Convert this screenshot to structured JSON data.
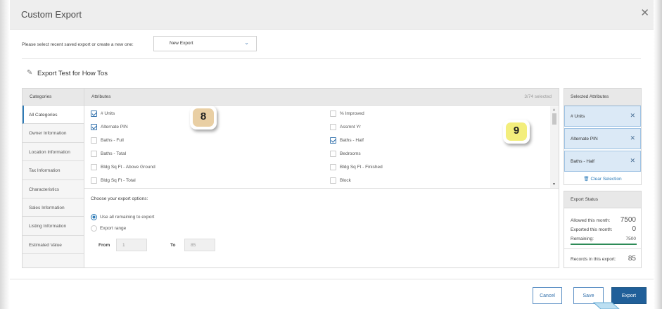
{
  "dialog": {
    "title": "Custom Export"
  },
  "saved_export": {
    "label": "Please select recent saved export or create a new one:",
    "value": "New Export"
  },
  "export_name": "Export Test for How Tos",
  "categories": {
    "header": "Categories",
    "items": [
      "All Categories",
      "Owner Information",
      "Location Information",
      "Tax Information",
      "Characteristics",
      "Sales Information",
      "Listing Information",
      "Estimated Value"
    ],
    "active": "All Categories"
  },
  "attributes": {
    "header": "Attributes",
    "count": "3/74 selected",
    "left_column": [
      {
        "label": "# Units",
        "checked": true
      },
      {
        "label": "Alternate PIN",
        "checked": true
      },
      {
        "label": "Baths - Full",
        "checked": false
      },
      {
        "label": "Baths - Total",
        "checked": false
      },
      {
        "label": "Bldg Sq Ft - Above Ground",
        "checked": false
      },
      {
        "label": "Bldg Sq Ft - Total",
        "checked": false
      }
    ],
    "right_column": [
      {
        "label": "% Improved",
        "checked": false
      },
      {
        "label": "Assmnt Yr",
        "checked": false
      },
      {
        "label": "Baths - Half",
        "checked": true
      },
      {
        "label": "Bedrooms",
        "checked": false
      },
      {
        "label": "Bldg Sq Ft - Finished",
        "checked": false
      },
      {
        "label": "Block",
        "checked": false
      }
    ]
  },
  "export_options": {
    "title": "Choose your export options:",
    "option_all": "Use all remaining to export",
    "option_range": "Export range",
    "selected": "all",
    "from_label": "From",
    "from_value": "1",
    "to_label": "To",
    "to_value": "85"
  },
  "selected_attributes": {
    "header": "Selected Attributes",
    "items": [
      "# Units",
      "Alternate PIN",
      "Baths - Half"
    ],
    "clear_label": "Clear Selection"
  },
  "export_status": {
    "header": "Export Status",
    "allowed_label": "Allowed this month:",
    "allowed_value": "7500",
    "exported_label": "Exported this month:",
    "exported_value": "0",
    "remaining_label": "Remaining:",
    "remaining_value": "7500",
    "records_label": "Records in this export:",
    "records_value": "85"
  },
  "buttons": {
    "cancel": "Cancel",
    "save": "Save",
    "export": "Export"
  },
  "callouts": {
    "first": "8",
    "second": "9"
  },
  "colors": {
    "accent": "#205f99",
    "selected_bg": "#dbe9f6",
    "link": "#2f7cb8",
    "progress": "#2e8b57"
  }
}
